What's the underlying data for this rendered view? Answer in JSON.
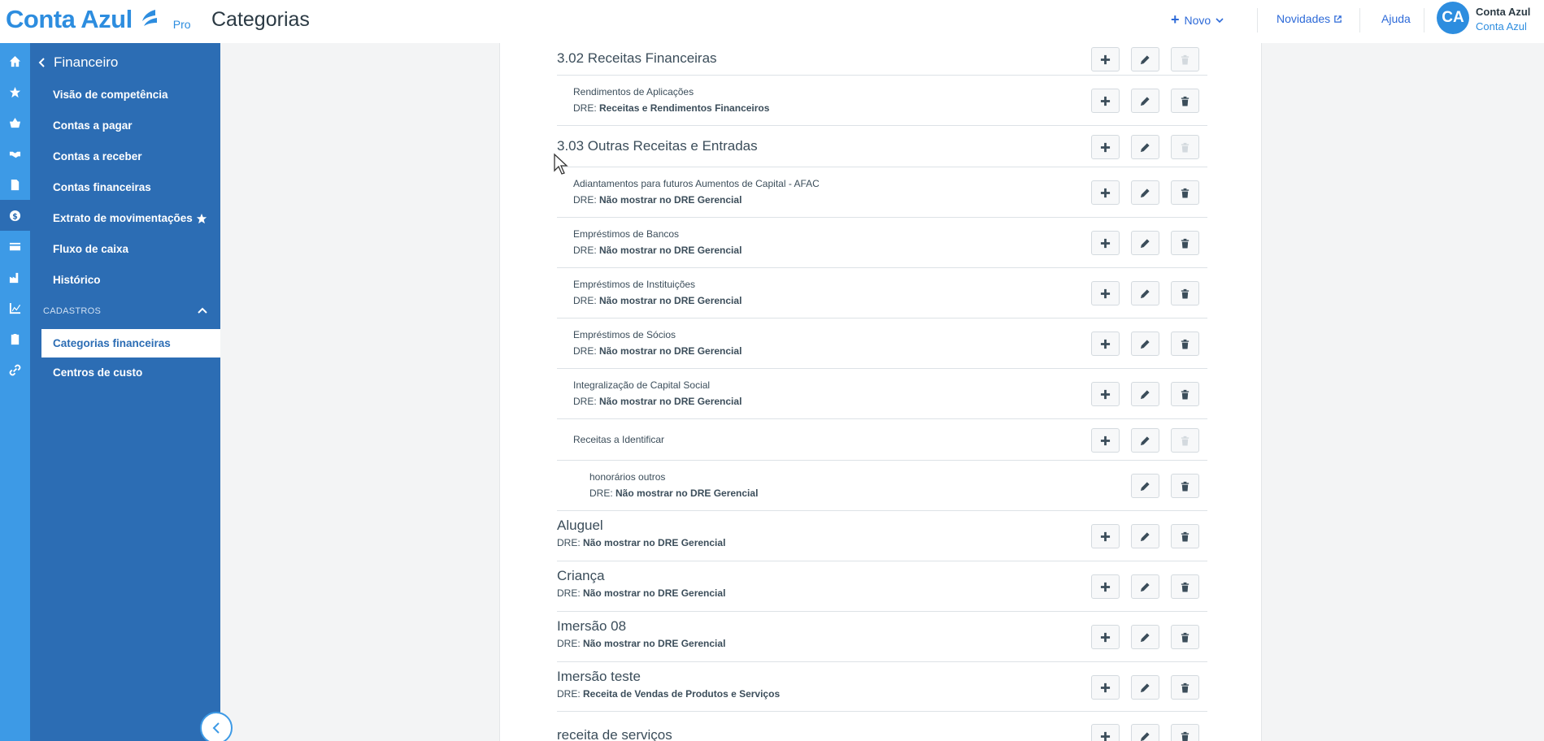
{
  "header": {
    "logo_text": "Conta Azul",
    "logo_plan": "Pro",
    "title": "Categorias",
    "novo_label": "Novo",
    "novidades_label": "Novidades",
    "ajuda_label": "Ajuda",
    "avatar_initials": "CA",
    "user_name": "Conta Azul",
    "user_company": "Conta Azul"
  },
  "rail": {
    "icons": [
      "home-icon",
      "star-icon",
      "basket-icon",
      "handshake-icon",
      "document-icon",
      "dollar-icon",
      "card-icon",
      "factory-icon",
      "chart-icon",
      "clipboard-icon",
      "link-icon"
    ],
    "active_index": 5
  },
  "sidemenu": {
    "back_label": "Financeiro",
    "items": [
      "Visão de competência",
      "Contas a pagar",
      "Contas a receber",
      "Contas financeiras",
      "Extrato de movimentações",
      "Fluxo de caixa",
      "Histórico"
    ],
    "section_title": "CADASTROS",
    "section_items": [
      "Categorias financeiras",
      "Centros de custo"
    ],
    "active_item": "Categorias financeiras"
  },
  "categories": {
    "dre_prefix": "DRE:",
    "rows": [
      {
        "name": "3.02 Receitas Financeiras",
        "level": 0,
        "dre": "",
        "delete_enabled": false
      },
      {
        "name": "Rendimentos de Aplicações",
        "level": 1,
        "dre": "Receitas e Rendimentos Financeiros",
        "delete_enabled": true
      },
      {
        "name": "3.03 Outras Receitas e Entradas",
        "level": 0,
        "dre": "",
        "delete_enabled": false
      },
      {
        "name": "Adiantamentos para futuros Aumentos de Capital - AFAC",
        "level": 1,
        "dre": "Não mostrar no DRE Gerencial",
        "delete_enabled": true
      },
      {
        "name": "Empréstimos de Bancos",
        "level": 1,
        "dre": "Não mostrar no DRE Gerencial",
        "delete_enabled": true
      },
      {
        "name": "Empréstimos de Instituições",
        "level": 1,
        "dre": "Não mostrar no DRE Gerencial",
        "delete_enabled": true
      },
      {
        "name": "Empréstimos de Sócios",
        "level": 1,
        "dre": "Não mostrar no DRE Gerencial",
        "delete_enabled": true
      },
      {
        "name": "Integralização de Capital Social",
        "level": 1,
        "dre": "Não mostrar no DRE Gerencial",
        "delete_enabled": true
      },
      {
        "name": "Receitas a Identificar",
        "level": 1,
        "dre": "",
        "delete_enabled": false
      },
      {
        "name": "honorários outros",
        "level": 2,
        "dre": "Não mostrar no DRE Gerencial",
        "delete_enabled": true
      },
      {
        "name": "Aluguel",
        "level": 0,
        "dre": "Não mostrar no DRE Gerencial",
        "delete_enabled": true
      },
      {
        "name": "Criança",
        "level": 0,
        "dre": "Não mostrar no DRE Gerencial",
        "delete_enabled": true
      },
      {
        "name": "Imersão 08",
        "level": 0,
        "dre": "Não mostrar no DRE Gerencial",
        "delete_enabled": true
      },
      {
        "name": "Imersão teste",
        "level": 0,
        "dre": "Receita de Vendas de Produtos e Serviços",
        "delete_enabled": true
      },
      {
        "name": "receita de serviços",
        "level": 0,
        "dre": "",
        "delete_enabled": true
      }
    ]
  },
  "colors": {
    "brand": "#2d8ddf",
    "rail": "#3d9ae6",
    "sidemenu": "#2c6db4"
  }
}
